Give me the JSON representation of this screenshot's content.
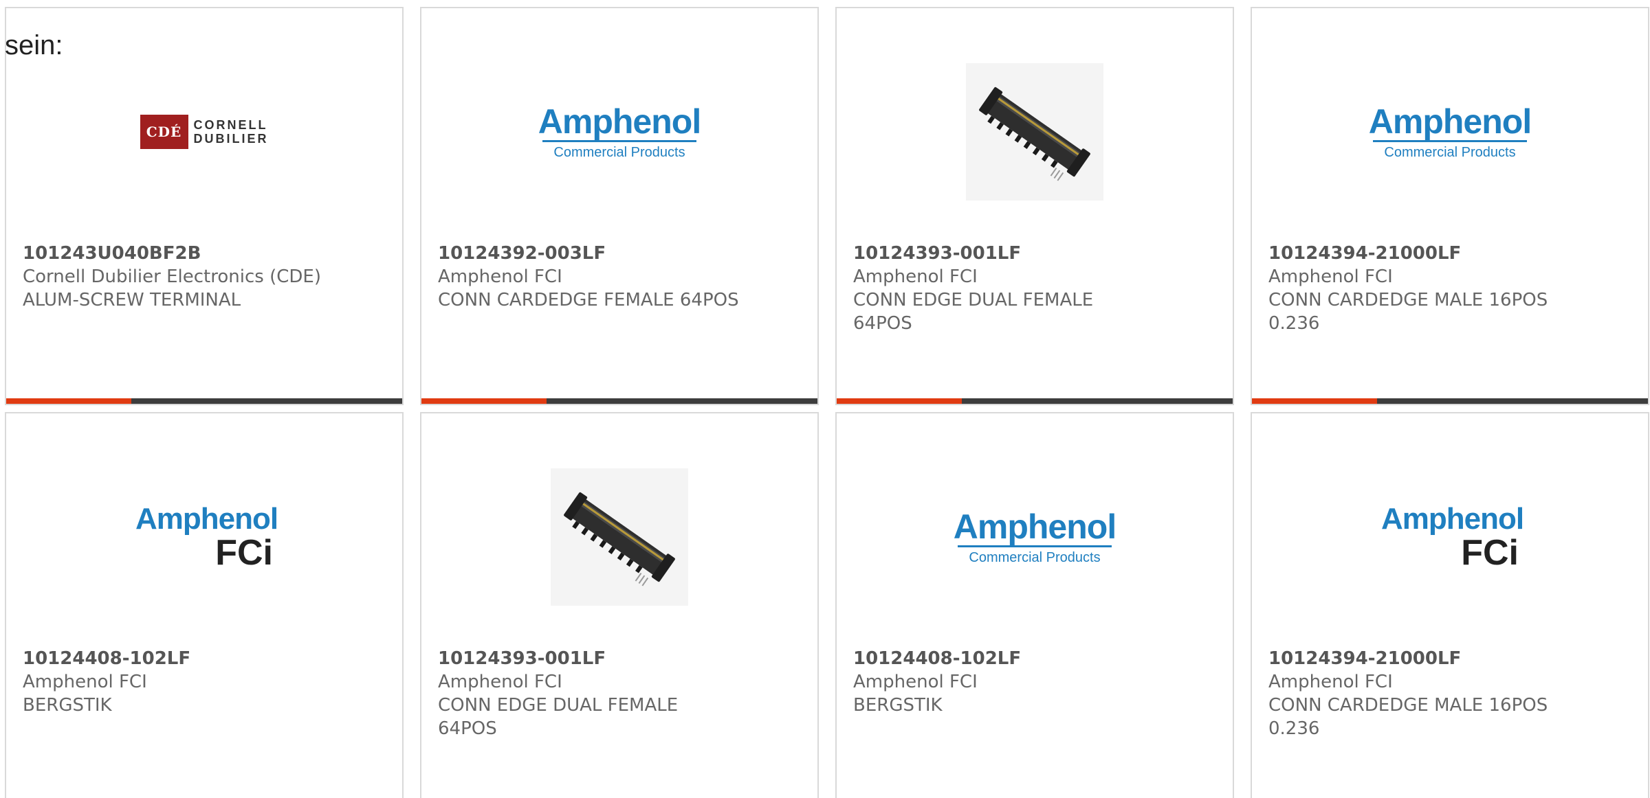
{
  "lead_text": "sein:",
  "colors": {
    "accent_bar": "#e03b12",
    "bar_track": "#3d3d3d",
    "amphenol_blue": "#1f7fc0",
    "cde_red": "#a01f1f",
    "card_border": "#d9d9d9"
  },
  "cards": [
    {
      "image": "cde-logo",
      "logo_text": {
        "mark": "CDÉ",
        "line1": "CORNELL",
        "line2": "DUBILIER"
      },
      "part_number": "101243U040BF2B",
      "manufacturer": "Cornell Dubilier Electronics (CDE)",
      "description": "ALUM-SCREW TERMINAL"
    },
    {
      "image": "amphenol-commercial-logo",
      "logo_text": {
        "main": "Amphenol",
        "sub": "Commercial Products"
      },
      "part_number": "10124392-003LF",
      "manufacturer": "Amphenol FCI",
      "description": "CONN CARDEDGE FEMALE 64POS"
    },
    {
      "image": "edge-connector-photo",
      "part_number": "10124393-001LF",
      "manufacturer": "Amphenol FCI",
      "description": "CONN EDGE DUAL FEMALE 64POS"
    },
    {
      "image": "amphenol-commercial-logo",
      "logo_text": {
        "main": "Amphenol",
        "sub": "Commercial Products"
      },
      "part_number": "10124394-21000LF",
      "manufacturer": "Amphenol FCI",
      "description": "CONN CARDEDGE MALE 16POS 0.236"
    },
    {
      "image": "amphenol-fci-logo",
      "logo_text": {
        "main": "Amphenol",
        "sub": "FCi"
      },
      "part_number": "10124408-102LF",
      "manufacturer": "Amphenol FCI",
      "description": "BERGSTIK"
    },
    {
      "image": "edge-connector-photo",
      "part_number": "10124393-001LF",
      "manufacturer": "Amphenol FCI",
      "description": "CONN EDGE DUAL FEMALE 64POS"
    },
    {
      "image": "amphenol-commercial-logo",
      "logo_text": {
        "main": "Amphenol",
        "sub": "Commercial Products"
      },
      "part_number": "10124408-102LF",
      "manufacturer": "Amphenol FCI",
      "description": "BERGSTIK"
    },
    {
      "image": "amphenol-fci-logo",
      "logo_text": {
        "main": "Amphenol",
        "sub": "FCi"
      },
      "part_number": "10124394-21000LF",
      "manufacturer": "Amphenol FCI",
      "description": "CONN CARDEDGE MALE 16POS 0.236"
    }
  ]
}
